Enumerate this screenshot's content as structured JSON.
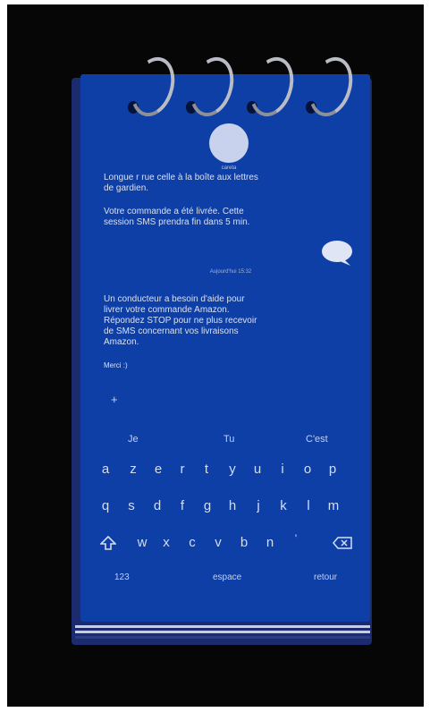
{
  "conversation": {
    "contact_name": "careta",
    "messages_top": [
      "Longue r rue celle à la boîte aux lettres",
      "de gardien.",
      "",
      "Votre commande a été livrée. Cette",
      "session SMS prendra fin dans 5 min."
    ],
    "timestamp": "Aujourd'hui 15:32",
    "messages_bottom": [
      "Un conducteur a besoin d'aide pour",
      "livrer votre commande Amazon.",
      "Répondez STOP pour ne plus recevoir",
      "de SMS concernant vos livraisons",
      "Amazon."
    ],
    "reply": "Merci :)"
  },
  "compose": {
    "plus_label": "+"
  },
  "keyboard": {
    "suggestions": [
      "Je",
      "Tu",
      "C'est"
    ],
    "row1": [
      "a",
      "z",
      "e",
      "r",
      "t",
      "y",
      "u",
      "i",
      "o",
      "p"
    ],
    "row2": [
      "q",
      "s",
      "d",
      "f",
      "g",
      "h",
      "j",
      "k",
      "l",
      "m"
    ],
    "row3": [
      "w",
      "x",
      "c",
      "v",
      "b",
      "n",
      "'"
    ],
    "numbers_label": "123",
    "space_label": "espace",
    "return_label": "retour"
  },
  "colors": {
    "paper": "#0e3fa6",
    "background": "#060606",
    "ink": "#d8e0f2"
  }
}
